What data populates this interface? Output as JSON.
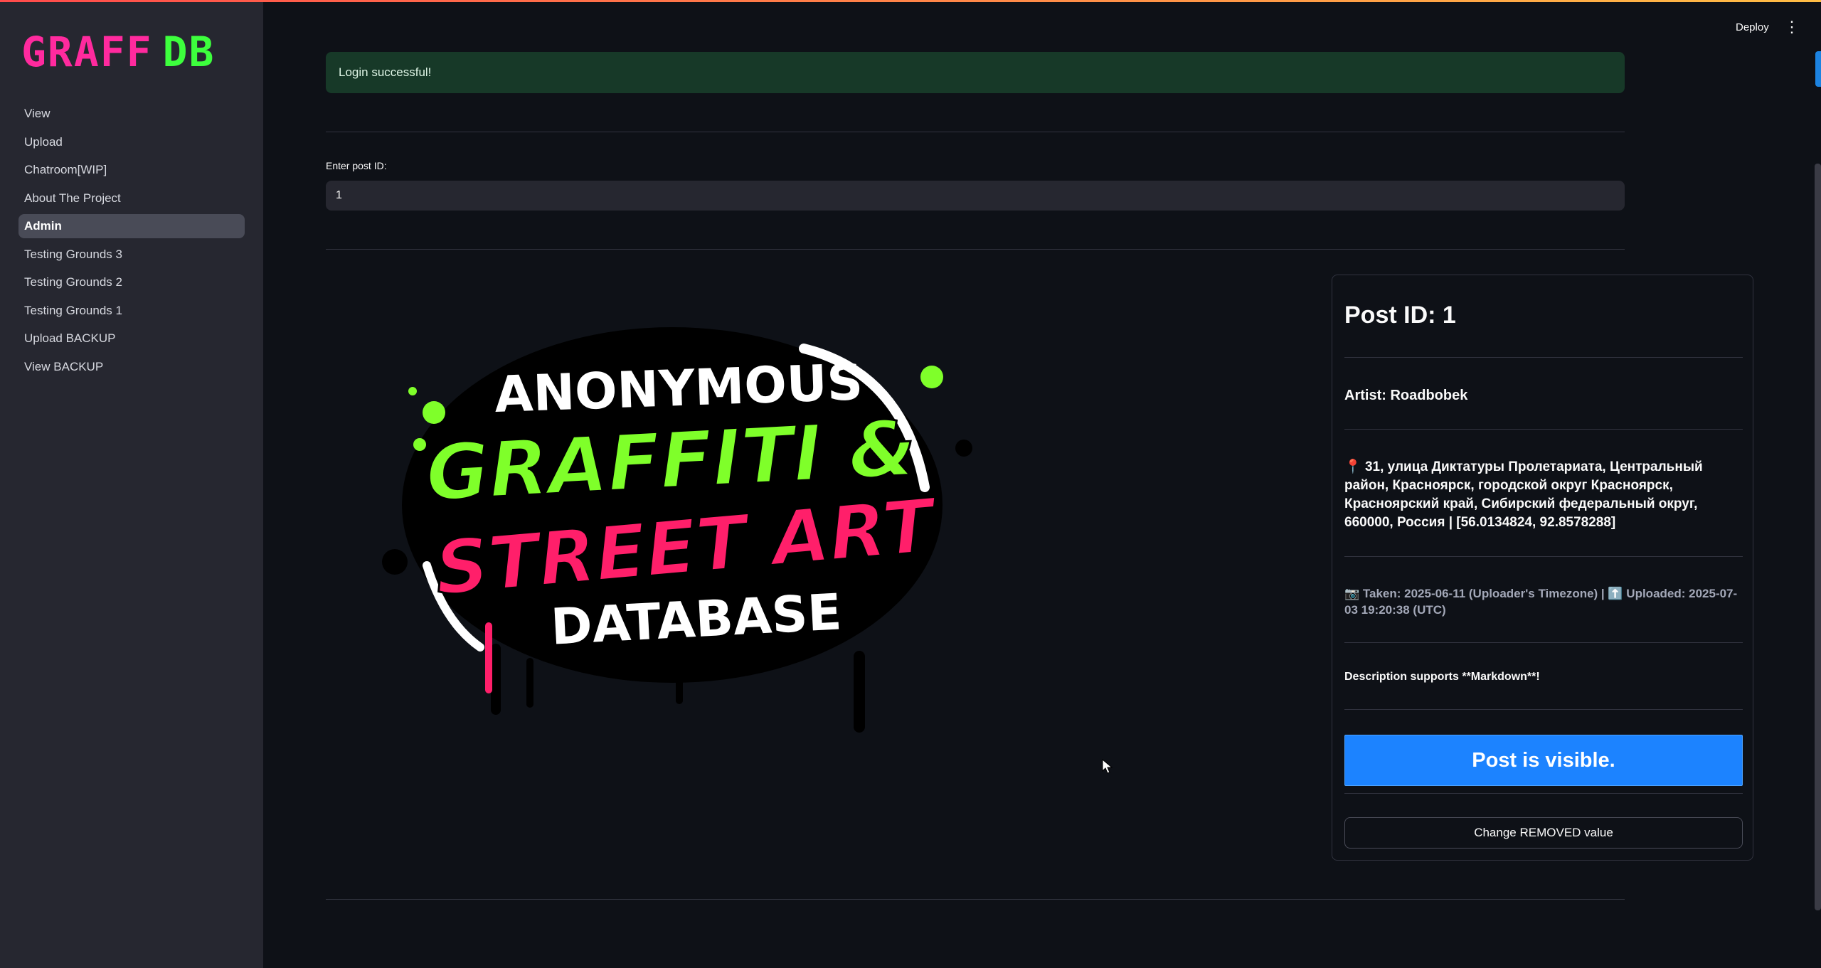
{
  "app": {
    "logo_part1": "GRAFF",
    "logo_part2": "DB",
    "deploy_label": "Deploy",
    "menu_icon": "kebab-menu-icon"
  },
  "sidebar": {
    "items": [
      {
        "label": "View",
        "active": false
      },
      {
        "label": "Upload",
        "active": false
      },
      {
        "label": "Chatroom[WIP]",
        "active": false
      },
      {
        "label": "About The Project",
        "active": false
      },
      {
        "label": "Admin",
        "active": true
      },
      {
        "label": "Testing Grounds 3",
        "active": false
      },
      {
        "label": "Testing Grounds 2",
        "active": false
      },
      {
        "label": "Testing Grounds 1",
        "active": false
      },
      {
        "label": "Upload BACKUP",
        "active": false
      },
      {
        "label": "View BACKUP",
        "active": false
      }
    ]
  },
  "main": {
    "success_message": "Login successful!",
    "post_input": {
      "label": "Enter post ID:",
      "value": "1"
    },
    "image": {
      "line1": "ANONYMOUS",
      "line2": "GRAFFITI &",
      "line3": "STREET ART",
      "line4": "DATABASE"
    },
    "post": {
      "title": "Post ID: 1",
      "artist": "Artist: Roadbobek",
      "location_icon": "📍",
      "location": "31, улица Диктатуры Пролетариата, Центральный район, Красноярск, городской округ Красноярск, Красноярский край, Сибирский федеральный округ, 660000, Россия | [56.0134824, 92.8578288]",
      "dates": "📷 Taken: 2025-06-11 (Uploader's Timezone) | ⬆️ Uploaded: 2025-07-03 19:20:38 (UTC)",
      "description": "Description supports **Markdown**!",
      "visible_button": "Post is visible.",
      "change_button": "Change REMOVED value"
    }
  },
  "colors": {
    "background": "#0e1117",
    "sidebar": "#262730",
    "success_bg": "#173928",
    "primary": "#1c83ff",
    "logo_pink": "#ff2a9e",
    "logo_green": "#3dff3d",
    "graffiti_green": "#7fff2a",
    "graffiti_pink": "#ff1f6a"
  }
}
